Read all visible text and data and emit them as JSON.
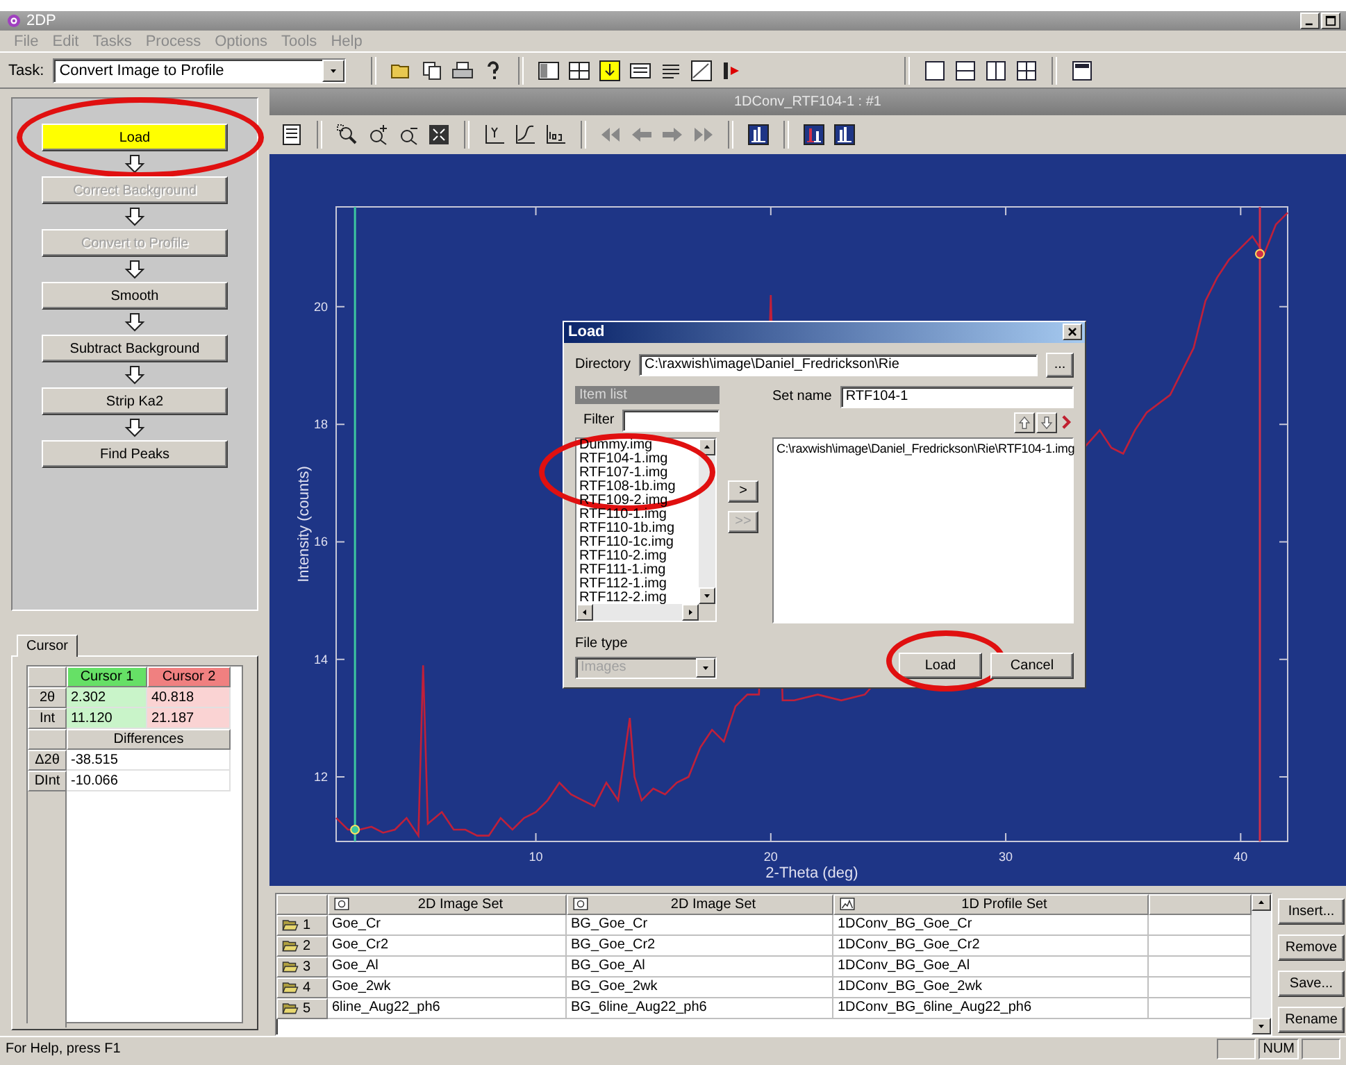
{
  "window": {
    "title": "2DP"
  },
  "menu": [
    {
      "label": "File",
      "disabled": true
    },
    {
      "label": "Edit",
      "disabled": true
    },
    {
      "label": "Tasks",
      "disabled": true
    },
    {
      "label": "Process",
      "disabled": true
    },
    {
      "label": "Options",
      "disabled": true
    },
    {
      "label": "Tools",
      "disabled": true
    },
    {
      "label": "Help",
      "disabled": true
    }
  ],
  "task": {
    "label": "Task:",
    "value": "Convert Image to Profile"
  },
  "steps": [
    {
      "label": "Load",
      "selected": true,
      "disabled": false,
      "circled": true
    },
    {
      "label": "Correct Background",
      "selected": false,
      "disabled": true,
      "circled": false
    },
    {
      "label": "Convert to Profile",
      "selected": false,
      "disabled": true,
      "circled": false
    },
    {
      "label": "Smooth",
      "selected": false,
      "disabled": false,
      "circled": false
    },
    {
      "label": "Subtract Background",
      "selected": false,
      "disabled": false,
      "circled": false
    },
    {
      "label": "Strip Ka2",
      "selected": false,
      "disabled": false,
      "circled": false
    },
    {
      "label": "Find Peaks",
      "selected": false,
      "disabled": false,
      "circled": false
    }
  ],
  "cursor_panel": {
    "tab": "Cursor",
    "columns": [
      {
        "label": "Cursor 1",
        "color": "#66e066"
      },
      {
        "label": "Cursor 2",
        "color": "#f08080"
      }
    ],
    "rows": [
      {
        "label": "2θ",
        "values": [
          "2.302",
          "40.818"
        ]
      },
      {
        "label": "Int",
        "values": [
          "11.120",
          "21.187"
        ]
      }
    ],
    "differences_title": "Differences",
    "difference_rows": [
      {
        "label": "Δ2θ",
        "value": "-38.515"
      },
      {
        "label": "DInt",
        "value": "-10.066"
      }
    ]
  },
  "plot": {
    "title": "1DConv_RTF104-1 : #1",
    "chart_data": {
      "type": "line",
      "xlabel": "2-Theta (deg)",
      "ylabel": "Intensity (counts)",
      "xlim": [
        1.5,
        42
      ],
      "ylim": [
        10.9,
        21.7
      ],
      "xticks": [
        10,
        20,
        30,
        40
      ],
      "yticks": [
        12,
        14,
        16,
        18,
        20
      ],
      "x": [
        1.5,
        2,
        2.5,
        3,
        3.5,
        4,
        4.5,
        5,
        5.2,
        5.4,
        6,
        6.5,
        7,
        7.5,
        8,
        8.5,
        9,
        9.5,
        10,
        10.5,
        11,
        11.5,
        12,
        12.5,
        13,
        13.5,
        14,
        14.2,
        14.5,
        15,
        15.5,
        16,
        16.5,
        17,
        17.5,
        18,
        18.5,
        19,
        19.5,
        20,
        20.5,
        21,
        22,
        23,
        24,
        34,
        34.5,
        35,
        35.5,
        36,
        37,
        38,
        38.5,
        39,
        39.5,
        40,
        40.5,
        41,
        41.5,
        42
      ],
      "series": [
        {
          "color": "#c0203a",
          "values": [
            11.3,
            11.1,
            11.1,
            11.15,
            11.05,
            11.1,
            11.3,
            11.0,
            13.9,
            11.2,
            11.4,
            11.1,
            11.1,
            11.0,
            11.0,
            11.3,
            11.1,
            11.3,
            11.4,
            11.6,
            11.9,
            11.7,
            11.6,
            11.5,
            11.9,
            11.6,
            13.0,
            12.0,
            11.6,
            11.8,
            11.7,
            11.9,
            12.0,
            12.5,
            12.8,
            12.6,
            13.2,
            13.4,
            13.4,
            20.2,
            13.3,
            13.3,
            13.4,
            13.3,
            13.4,
            17.9,
            17.6,
            17.5,
            17.9,
            18.2,
            18.5,
            19.3,
            20.1,
            20.5,
            20.8,
            21.0,
            21.2,
            20.9,
            21.4,
            21.6
          ]
        }
      ],
      "ref_lines": [
        {
          "axis": "x",
          "value": 2.302,
          "color": "#3cc8a0"
        },
        {
          "axis": "x",
          "value": 40.818,
          "color": "#d03048"
        }
      ]
    }
  },
  "load_dialog": {
    "title": "Load",
    "directory_label": "Directory",
    "directory": "C:\\raxwish\\image\\Daniel_Fredrickson\\Rie",
    "browse": "...",
    "item_list_title": "Item list",
    "filter_label": "Filter",
    "items_circled": true,
    "items": [
      "Dummy.img",
      "RTF104-1.img",
      "RTF107-1.img",
      "RTF108-1b.img",
      "RTF109-2.img",
      "RTF110-1.img",
      "RTF110-1b.img",
      "RTF110-1c.img",
      "RTF110-2.img",
      "RTF111-1.img",
      "RTF112-1.img",
      "RTF112-2.img"
    ],
    "add_button": {
      "label": ">",
      "disabled": false
    },
    "add_all_button": {
      "label": ">>",
      "disabled": true
    },
    "file_type_label": "File type",
    "file_type": {
      "value": "Images",
      "disabled": true
    },
    "set_name_label": "Set name",
    "set_name": "RTF104-1",
    "selected_files": [
      "C:\\raxwish\\image\\Daniel_Fredrickson\\Rie\\RTF104-1.img"
    ],
    "buttons": [
      {
        "label": "Load",
        "circled": true
      },
      {
        "label": "Cancel",
        "circled": false
      }
    ]
  },
  "sets_table": {
    "columns": [
      {
        "label": "2D Image Set",
        "kind": "image"
      },
      {
        "label": "2D Image Set",
        "kind": "image"
      },
      {
        "label": "1D Profile Set",
        "kind": "profile"
      }
    ],
    "rows": [
      {
        "number": "1",
        "cells": [
          "Goe_Cr",
          "BG_Goe_Cr",
          "1DConv_BG_Goe_Cr"
        ]
      },
      {
        "number": "2",
        "cells": [
          "Goe_Cr2",
          "BG_Goe_Cr2",
          "1DConv_BG_Goe_Cr2"
        ]
      },
      {
        "number": "3",
        "cells": [
          "Goe_Al",
          "BG_Goe_Al",
          "1DConv_BG_Goe_Al"
        ]
      },
      {
        "number": "4",
        "cells": [
          "Goe_2wk",
          "BG_Goe_2wk",
          "1DConv_BG_Goe_2wk"
        ]
      },
      {
        "number": "5",
        "cells": [
          "6line_Aug22_ph6",
          "BG_6line_Aug22_ph6",
          "1DConv_BG_6line_Aug22_ph6"
        ]
      }
    ]
  },
  "side_buttons": [
    "Insert...",
    "Remove",
    "Save...",
    "Rename"
  ],
  "status_bar": {
    "text": "For Help, press F1",
    "indicators": [
      "NUM"
    ]
  }
}
